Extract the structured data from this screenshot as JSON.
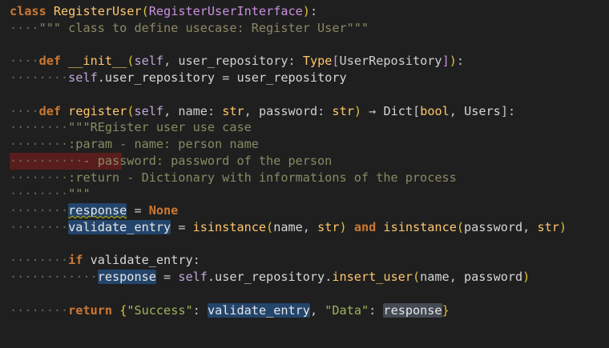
{
  "editor": {
    "language": "python",
    "colors": {
      "background": "#1f1f1f",
      "keyword": "#cc7832",
      "function": "#ffc66d",
      "string": "#9cb45c",
      "docstring": "#8a8a64",
      "selection": "#24456b",
      "error_line": "#5a1d1d"
    },
    "lines": [
      {
        "ws": "",
        "text": "class RegisterUser(RegisterUserInterface):"
      },
      {
        "ws": "····",
        "text": "\"\"\" class to define usecase: Register User\"\"\""
      },
      {
        "ws": "",
        "text": ""
      },
      {
        "ws": "····",
        "text": "def __init__(self, user_repository: Type[UserRepository]):"
      },
      {
        "ws": "········",
        "text": "self.user_repository = user_repository"
      },
      {
        "ws": "",
        "text": ""
      },
      {
        "ws": "····",
        "text": "def register(self, name: str, password: str) → Dict[bool, Users]:"
      },
      {
        "ws": "········",
        "text": "\"\"\"REgister user use case"
      },
      {
        "ws": "········",
        "text": ":param - name: person name"
      },
      {
        "ws": "··········",
        "text": "- password: password of the person"
      },
      {
        "ws": "········",
        "text": ":return - Dictionary with informations of the process"
      },
      {
        "ws": "········",
        "text": "\"\"\""
      },
      {
        "ws": "········",
        "text": "response = None"
      },
      {
        "ws": "········",
        "text": "validate_entry = isinstance(name, str) and isinstance(password, str)"
      },
      {
        "ws": "",
        "text": ""
      },
      {
        "ws": "········",
        "text": "if validate_entry:"
      },
      {
        "ws": "············",
        "text": "response = self.user_repository.insert_user(name, password)"
      },
      {
        "ws": "",
        "text": ""
      },
      {
        "ws": "········",
        "text": "return {\"Success\": validate_entry, \"Data\": response}"
      }
    ]
  },
  "t": {
    "class_kw": "class",
    "class_name": "RegisterUser",
    "super_name": "RegisterUserInterface",
    "docstring_cls": "\"\"\" class to define usecase: Register User\"\"\"",
    "def_kw": "def",
    "init_name": "__init__",
    "self": "self",
    "p_user_repo": "user_repository",
    "type_kw": "Type",
    "user_repository_cls": "UserRepository",
    "self_attr": ".user_repository",
    "assign": "=",
    "user_repo_val": "user_repository",
    "register_name": "register",
    "p_name": "name",
    "p_password": "password",
    "str_kw": "str",
    "arrow": "→",
    "dict_kw": "Dict",
    "bool_kw": "bool",
    "users_kw": "Users",
    "doc1": "\"\"\"REgister user use case",
    "doc2": ":param - name: person name",
    "doc3": "- password: password of the person",
    "doc4": ":return - Dictionary with informations of the process",
    "doc5": "\"\"\"",
    "response": "response",
    "none_kw": "None",
    "validate_entry": "validate_entry",
    "isinstance": "isinstance",
    "and_kw": "and",
    "if_kw": "if",
    "insert_user": "insert_user",
    "return_kw": "return",
    "success_key": "\"Success\"",
    "data_key": "\"Data\""
  }
}
